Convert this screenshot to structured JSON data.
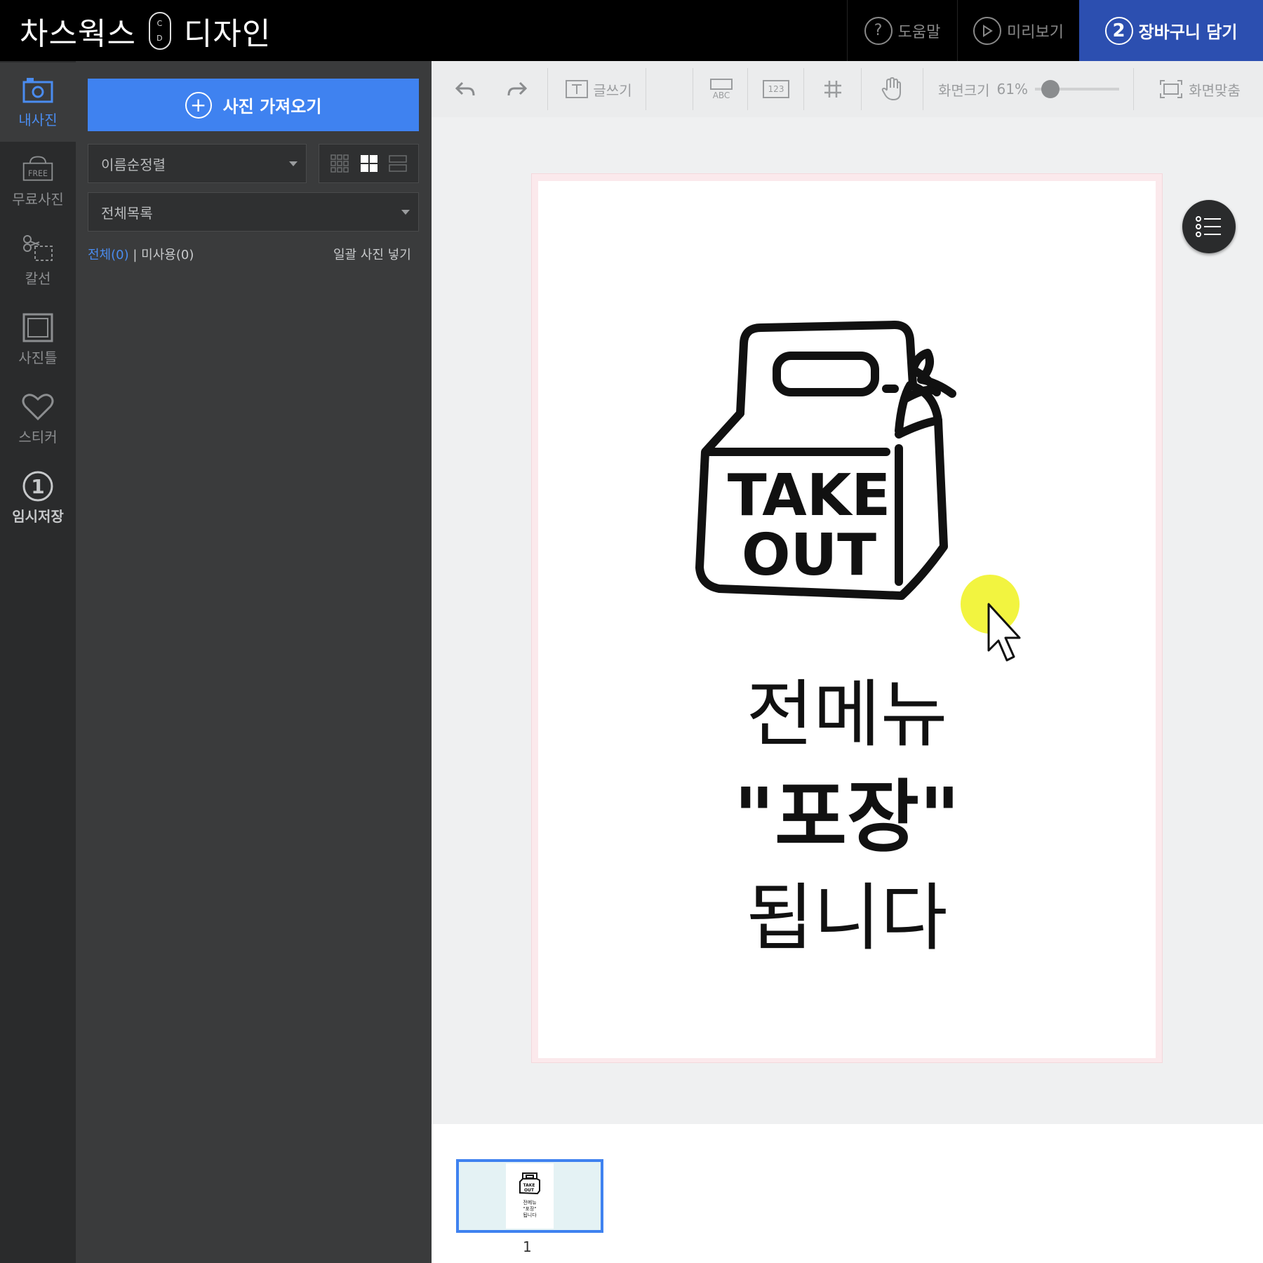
{
  "app": {
    "logo_left": "차스웍스",
    "logo_pill": [
      "C",
      "D"
    ],
    "logo_right": "디자인"
  },
  "topnav": {
    "help": "도움말",
    "help_glyph": "?",
    "preview": "미리보기",
    "cart_step": "2",
    "cart": "장바구니 담기"
  },
  "sidebar": {
    "items": [
      {
        "label": "내사진",
        "icon": "camera-icon"
      },
      {
        "label": "무료사진",
        "icon": "free-photo-icon"
      },
      {
        "label": "칼선",
        "icon": "scissors-icon"
      },
      {
        "label": "사진틀",
        "icon": "frame-icon"
      },
      {
        "label": "스티커",
        "icon": "heart-icon"
      },
      {
        "label": "임시저장",
        "icon": "save-one-icon",
        "badge": "1"
      }
    ]
  },
  "panel": {
    "import_label": "사진 가져오기",
    "sort_value": "이름순정렬",
    "folder_value": "전체목록",
    "filter_all": "전체(0)",
    "filter_sep": "|",
    "filter_unused": "미사용(0)",
    "bulk_insert": "일괄 사진 넣기"
  },
  "toolbar": {
    "write": "글쓰기",
    "abc": "ABC",
    "num": "123",
    "zoom_label": "화면크기",
    "zoom_value": "61%",
    "zoom_level": 0.1,
    "fit": "화면맞춤"
  },
  "canvas": {
    "bag_line1": "TAKE",
    "bag_line2": "OUT",
    "text_line1": "전메뉴",
    "text_line2": "\"포장\"",
    "text_line3": "됩니다"
  },
  "thumbnails": [
    {
      "page": "1"
    }
  ],
  "colors": {
    "accent": "#3f82f0",
    "cart_bg": "#2c4fb0",
    "highlight": "#eef000"
  }
}
